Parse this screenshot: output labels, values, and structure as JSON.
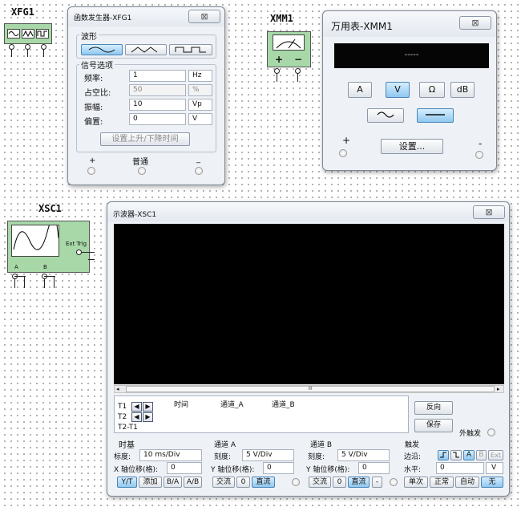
{
  "xfg1": {
    "label": "XFG1"
  },
  "xmm1": {
    "label": "XMM1",
    "plus": "+",
    "minus": "−"
  },
  "xsc1": {
    "label": "XSC1",
    "ext_trig": "Ext Trig",
    "a": "A",
    "b": "B"
  },
  "funcgen": {
    "title": "函数发生器-XFG1",
    "close": "⊠",
    "waveform_label": "波形",
    "signal_label": "信号选项",
    "rows": [
      {
        "label": "频率:",
        "value": "1",
        "unit": "Hz"
      },
      {
        "label": "占空比:",
        "value": "50",
        "unit": "%"
      },
      {
        "label": "振幅:",
        "value": "10",
        "unit": "Vp"
      },
      {
        "label": "偏置:",
        "value": "0",
        "unit": "V"
      }
    ],
    "rise_fall": "设置上升/下降时间",
    "plus": "+",
    "common": "普通",
    "minus": "_"
  },
  "multimeter": {
    "title": "万用表-XMM1",
    "close": "⊠",
    "display": "-----",
    "modes": [
      "A",
      "V",
      "Ω",
      "dB"
    ],
    "plus": "+",
    "set": "设置...",
    "minus": "-"
  },
  "scope": {
    "title": "示波器-XSC1",
    "close": "⊠",
    "scroll_mark": "III",
    "t1": "T1",
    "t2": "T2",
    "t21": "T2-T1",
    "col_time": "时间",
    "col_a": "通道_A",
    "col_b": "通道_B",
    "reverse": "反向",
    "save": "保存",
    "ext_trigger": "外触发",
    "timebase": {
      "title": "时基",
      "scale_label": "标度:",
      "scale": "10 ms/Div",
      "xpos_label": "X 轴位移(格):",
      "xpos": "0",
      "buttons": [
        "Y/T",
        "添加",
        "B/A",
        "A/B"
      ]
    },
    "channel_a": {
      "title": "通道 A",
      "scale_label": "刻度:",
      "scale": "5  V/Div",
      "ypos_label": "Y 轴位移(格):",
      "ypos": "0",
      "ac": "交流",
      "zero": "0",
      "dc": "直流"
    },
    "channel_b": {
      "title": "通道 B",
      "scale_label": "刻度:",
      "scale": "5  V/Div",
      "ypos_label": "Y 轴位移(格):",
      "ypos": "0",
      "ac": "交流",
      "zero": "0",
      "dc": "直流",
      "minus": "-"
    },
    "trigger": {
      "title": "触发",
      "edge_label": "边沿:",
      "level_label": "水平:",
      "level": "0",
      "level_unit": "V",
      "src": [
        "A",
        "B",
        "Ext"
      ],
      "modes": [
        "单次",
        "正常",
        "自动",
        "无"
      ]
    }
  },
  "colors": {
    "component": "#a8d8a8",
    "selected": "#8fc8f0",
    "screen": "#000000",
    "display": "#050505"
  }
}
